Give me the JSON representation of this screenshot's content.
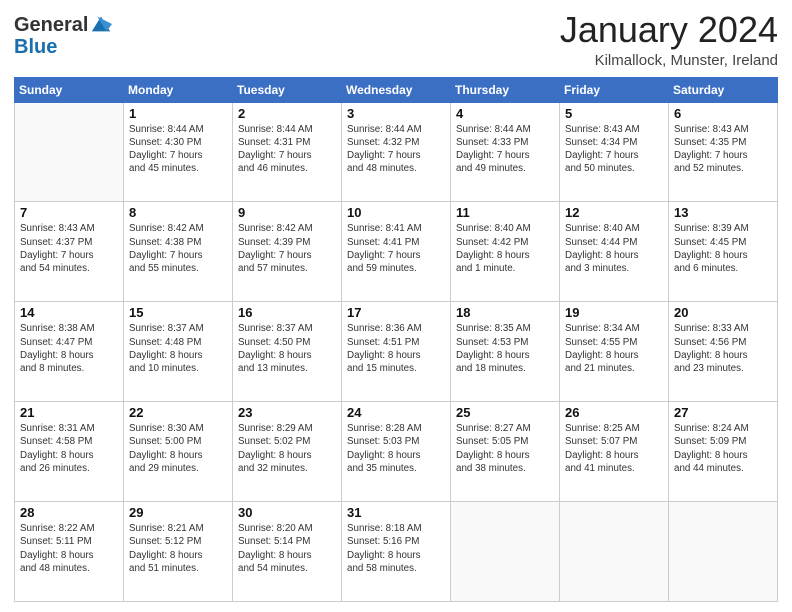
{
  "header": {
    "logo": {
      "line1": "General",
      "line2": "Blue"
    },
    "title": "January 2024",
    "location": "Kilmallock, Munster, Ireland"
  },
  "weekdays": [
    "Sunday",
    "Monday",
    "Tuesday",
    "Wednesday",
    "Thursday",
    "Friday",
    "Saturday"
  ],
  "weeks": [
    [
      {
        "day": "",
        "info": ""
      },
      {
        "day": "1",
        "info": "Sunrise: 8:44 AM\nSunset: 4:30 PM\nDaylight: 7 hours\nand 45 minutes."
      },
      {
        "day": "2",
        "info": "Sunrise: 8:44 AM\nSunset: 4:31 PM\nDaylight: 7 hours\nand 46 minutes."
      },
      {
        "day": "3",
        "info": "Sunrise: 8:44 AM\nSunset: 4:32 PM\nDaylight: 7 hours\nand 48 minutes."
      },
      {
        "day": "4",
        "info": "Sunrise: 8:44 AM\nSunset: 4:33 PM\nDaylight: 7 hours\nand 49 minutes."
      },
      {
        "day": "5",
        "info": "Sunrise: 8:43 AM\nSunset: 4:34 PM\nDaylight: 7 hours\nand 50 minutes."
      },
      {
        "day": "6",
        "info": "Sunrise: 8:43 AM\nSunset: 4:35 PM\nDaylight: 7 hours\nand 52 minutes."
      }
    ],
    [
      {
        "day": "7",
        "info": "Sunrise: 8:43 AM\nSunset: 4:37 PM\nDaylight: 7 hours\nand 54 minutes."
      },
      {
        "day": "8",
        "info": "Sunrise: 8:42 AM\nSunset: 4:38 PM\nDaylight: 7 hours\nand 55 minutes."
      },
      {
        "day": "9",
        "info": "Sunrise: 8:42 AM\nSunset: 4:39 PM\nDaylight: 7 hours\nand 57 minutes."
      },
      {
        "day": "10",
        "info": "Sunrise: 8:41 AM\nSunset: 4:41 PM\nDaylight: 7 hours\nand 59 minutes."
      },
      {
        "day": "11",
        "info": "Sunrise: 8:40 AM\nSunset: 4:42 PM\nDaylight: 8 hours\nand 1 minute."
      },
      {
        "day": "12",
        "info": "Sunrise: 8:40 AM\nSunset: 4:44 PM\nDaylight: 8 hours\nand 3 minutes."
      },
      {
        "day": "13",
        "info": "Sunrise: 8:39 AM\nSunset: 4:45 PM\nDaylight: 8 hours\nand 6 minutes."
      }
    ],
    [
      {
        "day": "14",
        "info": "Sunrise: 8:38 AM\nSunset: 4:47 PM\nDaylight: 8 hours\nand 8 minutes."
      },
      {
        "day": "15",
        "info": "Sunrise: 8:37 AM\nSunset: 4:48 PM\nDaylight: 8 hours\nand 10 minutes."
      },
      {
        "day": "16",
        "info": "Sunrise: 8:37 AM\nSunset: 4:50 PM\nDaylight: 8 hours\nand 13 minutes."
      },
      {
        "day": "17",
        "info": "Sunrise: 8:36 AM\nSunset: 4:51 PM\nDaylight: 8 hours\nand 15 minutes."
      },
      {
        "day": "18",
        "info": "Sunrise: 8:35 AM\nSunset: 4:53 PM\nDaylight: 8 hours\nand 18 minutes."
      },
      {
        "day": "19",
        "info": "Sunrise: 8:34 AM\nSunset: 4:55 PM\nDaylight: 8 hours\nand 21 minutes."
      },
      {
        "day": "20",
        "info": "Sunrise: 8:33 AM\nSunset: 4:56 PM\nDaylight: 8 hours\nand 23 minutes."
      }
    ],
    [
      {
        "day": "21",
        "info": "Sunrise: 8:31 AM\nSunset: 4:58 PM\nDaylight: 8 hours\nand 26 minutes."
      },
      {
        "day": "22",
        "info": "Sunrise: 8:30 AM\nSunset: 5:00 PM\nDaylight: 8 hours\nand 29 minutes."
      },
      {
        "day": "23",
        "info": "Sunrise: 8:29 AM\nSunset: 5:02 PM\nDaylight: 8 hours\nand 32 minutes."
      },
      {
        "day": "24",
        "info": "Sunrise: 8:28 AM\nSunset: 5:03 PM\nDaylight: 8 hours\nand 35 minutes."
      },
      {
        "day": "25",
        "info": "Sunrise: 8:27 AM\nSunset: 5:05 PM\nDaylight: 8 hours\nand 38 minutes."
      },
      {
        "day": "26",
        "info": "Sunrise: 8:25 AM\nSunset: 5:07 PM\nDaylight: 8 hours\nand 41 minutes."
      },
      {
        "day": "27",
        "info": "Sunrise: 8:24 AM\nSunset: 5:09 PM\nDaylight: 8 hours\nand 44 minutes."
      }
    ],
    [
      {
        "day": "28",
        "info": "Sunrise: 8:22 AM\nSunset: 5:11 PM\nDaylight: 8 hours\nand 48 minutes."
      },
      {
        "day": "29",
        "info": "Sunrise: 8:21 AM\nSunset: 5:12 PM\nDaylight: 8 hours\nand 51 minutes."
      },
      {
        "day": "30",
        "info": "Sunrise: 8:20 AM\nSunset: 5:14 PM\nDaylight: 8 hours\nand 54 minutes."
      },
      {
        "day": "31",
        "info": "Sunrise: 8:18 AM\nSunset: 5:16 PM\nDaylight: 8 hours\nand 58 minutes."
      },
      {
        "day": "",
        "info": ""
      },
      {
        "day": "",
        "info": ""
      },
      {
        "day": "",
        "info": ""
      }
    ]
  ]
}
